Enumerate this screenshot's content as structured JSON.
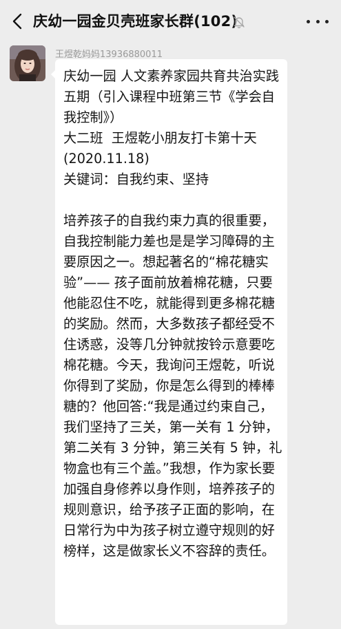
{
  "header": {
    "back_icon": "chevron-left-icon",
    "title": "庆幼一园金贝壳班家长群(102)",
    "mute_icon": "bell-off-icon",
    "more_icon": "more-dots-icon"
  },
  "message": {
    "sender_name": "王煜乾妈妈13936880011",
    "avatar_icon": "user-avatar",
    "paragraphs": [
      "庆幼一园 人文素养家园共育共治实践五期（引入课程中班第三节《学会自我控制》）\n大二班  王煜乾小朋友打卡第十天\n(2020.11.18)\n关键词：自我约束、坚持",
      "培养孩子的自我约束力真的很重要，自我控制能力差也是是学习障碍的主要原因之一。想起著名的“棉花糖实验”—— 孩子面前放着棉花糖，只要他能忍住不吃，就能得到更多棉花糖的奖励。然而，大多数孩子都经受不住诱惑，没等几分钟就按铃示意要吃棉花糖。今天，我询问王煜乾，听说你得到了奖励，你是怎么得到的棒棒糖的？他回答:“我是通过约束自己，我们坚持了三关，第一关有 1 分钟，第二关有 3 分钟，第三关有 5 钟，礼物盒也有三个盖。”我想，作为家长要加强自身修养以身作则，培养孩子的规则意识，给予孩子正面的影响，在日常行为中为孩子树立遵守规则的好榜样，这是做家长义不容辞的责任。"
    ]
  },
  "colors": {
    "background": "#ededed",
    "bubble": "#ffffff",
    "sender_text": "#9a9a9a",
    "text": "#151515"
  }
}
